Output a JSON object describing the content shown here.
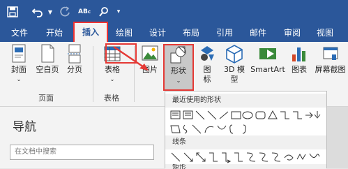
{
  "menu": {
    "items": [
      "文件",
      "开始",
      "插入",
      "绘图",
      "设计",
      "布局",
      "引用",
      "邮件",
      "审阅",
      "视图"
    ],
    "active": "插入"
  },
  "ribbon": {
    "cover_page": "封面",
    "blank_page": "空白页",
    "page_break": "分页",
    "table": "表格",
    "pictures": "图片",
    "shapes": "形状",
    "icons_line1": "图",
    "icons_line2": "标",
    "models_3d": "3D 模",
    "models_3d_line2": "型",
    "smartart": "SmartArt",
    "chart": "图表",
    "screenshot": "屏幕截图",
    "group_pages": "页面",
    "group_tables": "表格"
  },
  "navigation": {
    "title": "导航",
    "search_placeholder": "在文档中搜索"
  },
  "shapes_gallery": {
    "recent_header": "最近使用的形状",
    "lines_header": "线条",
    "next_header_partial": "矩形"
  },
  "colors": {
    "brand": "#2b579a",
    "highlight": "#e53935"
  }
}
